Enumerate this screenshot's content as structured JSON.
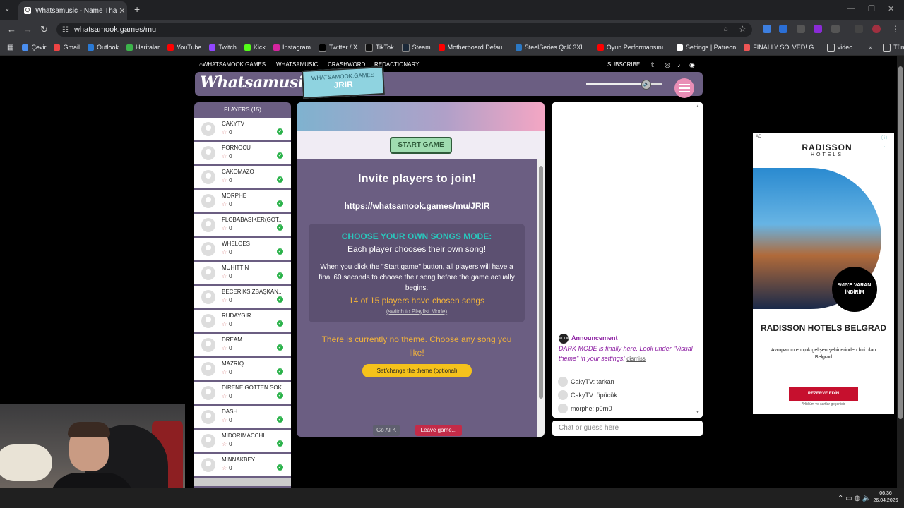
{
  "browser": {
    "tab_title": "Whatsamusic - Name That Tune",
    "tab_favicon": "Q",
    "url": "whatsamook.games/mu",
    "bookmarks": [
      "Çevir",
      "Gmail",
      "Outlook",
      "Haritalar",
      "YouTube",
      "Twitch",
      "Kick",
      "Instagram",
      "Twitter / X",
      "TikTok",
      "Steam",
      "Motherboard Defau...",
      "SteelSeries QcK 3XL...",
      "Oyun Performansını...",
      "Settings | Patreon",
      "FINALLY SOLVED! G...",
      "video"
    ],
    "bookmarks_more": "»",
    "bookmarks_all": "Tüm Yer İşaretleri"
  },
  "site_nav": {
    "home": "WHATSAMOOK.GAMES",
    "whatsamusic": "WHATSAMUSIC",
    "crashword": "CRASHWORD",
    "redactionary": "REDACTIONARY",
    "subscribe": "SUBSCRIBE"
  },
  "header": {
    "logo": "Whatsamusic",
    "room_site": "WHATSAMOOK.GAMES",
    "room_code": "JRIR",
    "volume": 0.78
  },
  "players": {
    "title": "PLAYERS (15)",
    "list": [
      {
        "name": "CAKYTV",
        "score": "0"
      },
      {
        "name": "PORNOCU",
        "score": "0"
      },
      {
        "name": "CAKOMAZO",
        "score": "0"
      },
      {
        "name": "MORPHE",
        "score": "0"
      },
      {
        "name": "FLOBABASİKER(GÖT...",
        "score": "0"
      },
      {
        "name": "WHELOES",
        "score": "0"
      },
      {
        "name": "MUHITTIN",
        "score": "0"
      },
      {
        "name": "BECERIKSIZBAŞKAN...",
        "score": "0"
      },
      {
        "name": "RUDAYGIR",
        "score": "0"
      },
      {
        "name": "DREAM",
        "score": "0"
      },
      {
        "name": "MAZRIQ",
        "score": "0"
      },
      {
        "name": "DIRENE GÖTTEN SOK...",
        "score": "0"
      },
      {
        "name": "DASH",
        "score": "0"
      },
      {
        "name": "MIDORIMACCHI",
        "score": "0"
      },
      {
        "name": "MINNAKBEY",
        "score": "0"
      }
    ]
  },
  "game": {
    "start_button": "START GAME",
    "invite_title": "Invite players to join!",
    "invite_url": "https://whatsamook.games/mu/JRIR",
    "mode_title": "CHOOSE YOUR OWN SONGS MODE:",
    "mode_subtitle": "Each player chooses their own song!",
    "mode_description": "When you click the \"Start game\" button, all players will have a final 60 seconds to choose their song before the game actually begins.",
    "chosen_count": "14 of 15 players have chosen songs",
    "switch_link": "(switch to Playlist Mode)",
    "theme_text": "There is currently no theme. Choose any song you like!",
    "theme_button": "Set/change the theme (optional)",
    "afk_button": "Go AFK",
    "leave_button": "Leave game..."
  },
  "chat": {
    "announcement_title": "Announcement",
    "announcement_icon": "MOOK",
    "announcement_body": "DARK MODE is finally here. Look under \"Visual theme\" in your settings!",
    "dismiss": "dismiss",
    "messages": [
      "CakyTV: tarkan",
      "CakyTV: öpücük",
      "morphe: p0rn0"
    ],
    "input_placeholder": "Chat or guess here"
  },
  "ad": {
    "label": "AD",
    "brand": "RADISSON",
    "brand_sub": "HOTELS",
    "badge": "%15'E VARAN İNDİRİM",
    "title": "RADISSON HOTELS BELGRAD",
    "subtitle": "Avrupa'nın en çok gelişen şehirlerinden biri olan Belgrad",
    "button": "REZERVE EDİN",
    "fine_print": "*Hüküm ve şartlar geçerlidir"
  },
  "taskbar": {
    "time": "06:36",
    "date": "26.04.2026"
  },
  "colors": {
    "accent_purple": "#6b5e82",
    "start_green": "#9fdcb0",
    "theme_yellow": "#f5c21b",
    "leave_red": "#c32b48",
    "mode_teal": "#29c7bd"
  }
}
